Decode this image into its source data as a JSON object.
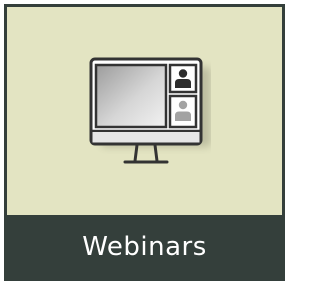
{
  "tile": {
    "label": "Webinars",
    "icon": "monitor-with-video-participants-icon",
    "colors": {
      "background": "#e3e4c2",
      "caption_bar": "#343f3b",
      "caption_text": "#ffffff",
      "outline": "#343f3b"
    }
  }
}
